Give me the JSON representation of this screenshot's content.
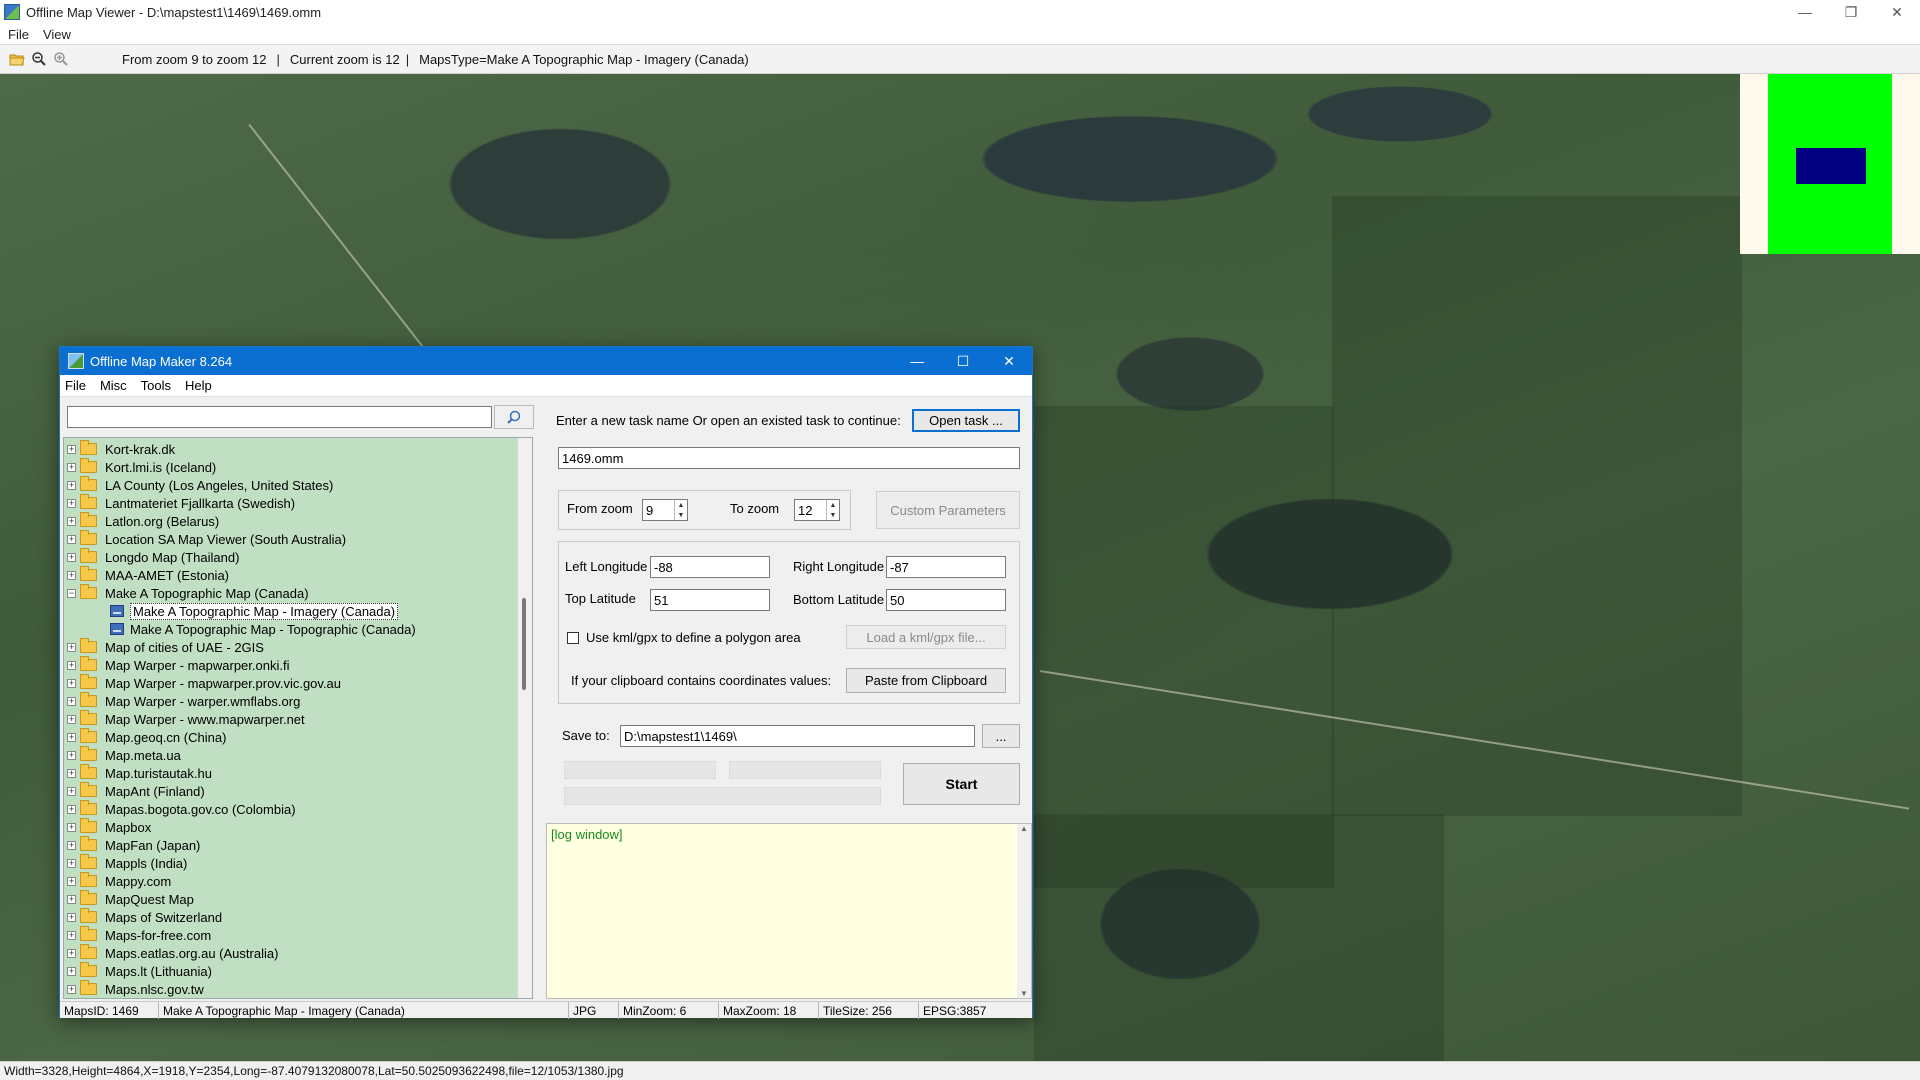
{
  "viewer": {
    "title": "Offline Map Viewer - D:\\mapstest1\\1469\\1469.omm",
    "window_buttons": {
      "minimize": "—",
      "restore": "❐",
      "close": "✕"
    },
    "menu": [
      "File",
      "View"
    ],
    "toolbar": {
      "zoom_range_text": "From zoom 9 to zoom 12",
      "sep": "|",
      "current_zoom_text": "Current zoom is 12",
      "maps_type_text": "MapsType=Make A Topographic Map - Imagery (Canada)"
    },
    "status": "Width=3328,Height=4864,X=1918,Y=2354,Long=-87.4079132080078,Lat=50.5025093622498,file=12/1053/1380.jpg",
    "minimap_colors": {
      "background": "#fff8ec",
      "coverage": "#00ff00",
      "viewport": "#000080"
    }
  },
  "dialog": {
    "title": "Offline Map Maker 8.264",
    "window_buttons": {
      "minimize": "—",
      "maximize": "☐",
      "close": "✕"
    },
    "menu": [
      "File",
      "Misc",
      "Tools",
      "Help"
    ],
    "search": {
      "value": "",
      "placeholder": ""
    },
    "tree": [
      {
        "label": "Kort-krak.dk",
        "type": "folder",
        "expander": "+"
      },
      {
        "label": "Kort.lmi.is (Iceland)",
        "type": "folder",
        "expander": "+"
      },
      {
        "label": "LA County (Los Angeles, United States)",
        "type": "folder",
        "expander": "+"
      },
      {
        "label": "Lantmateriet Fjallkarta (Swedish)",
        "type": "folder",
        "expander": "+"
      },
      {
        "label": "Latlon.org (Belarus)",
        "type": "folder",
        "expander": "+"
      },
      {
        "label": "Location SA Map Viewer (South Australia)",
        "type": "folder",
        "expander": "+"
      },
      {
        "label": "Longdo Map (Thailand)",
        "type": "folder",
        "expander": "+"
      },
      {
        "label": "MAA-AMET (Estonia)",
        "type": "folder",
        "expander": "+"
      },
      {
        "label": "Make A Topographic Map (Canada)",
        "type": "folder-open",
        "expander": "−"
      },
      {
        "label": "Make A Topographic Map - Imagery (Canada)",
        "type": "map",
        "selected": true
      },
      {
        "label": "Make A Topographic Map - Topographic (Canada)",
        "type": "map"
      },
      {
        "label": "Map of cities of UAE - 2GIS",
        "type": "folder",
        "expander": "+"
      },
      {
        "label": "Map Warper - mapwarper.onki.fi",
        "type": "folder",
        "expander": "+"
      },
      {
        "label": "Map Warper - mapwarper.prov.vic.gov.au",
        "type": "folder",
        "expander": "+"
      },
      {
        "label": "Map Warper - warper.wmflabs.org",
        "type": "folder",
        "expander": "+"
      },
      {
        "label": "Map Warper - www.mapwarper.net",
        "type": "folder",
        "expander": "+"
      },
      {
        "label": "Map.geoq.cn (China)",
        "type": "folder",
        "expander": "+"
      },
      {
        "label": "Map.meta.ua",
        "type": "folder",
        "expander": "+"
      },
      {
        "label": "Map.turistautak.hu",
        "type": "folder",
        "expander": "+"
      },
      {
        "label": "MapAnt (Finland)",
        "type": "folder",
        "expander": "+"
      },
      {
        "label": "Mapas.bogota.gov.co (Colombia)",
        "type": "folder",
        "expander": "+"
      },
      {
        "label": "Mapbox",
        "type": "folder",
        "expander": "+"
      },
      {
        "label": "MapFan (Japan)",
        "type": "folder",
        "expander": "+"
      },
      {
        "label": "Mappls (India)",
        "type": "folder",
        "expander": "+"
      },
      {
        "label": "Mappy.com",
        "type": "folder",
        "expander": "+"
      },
      {
        "label": "MapQuest Map",
        "type": "folder",
        "expander": "+"
      },
      {
        "label": "Maps of Switzerland",
        "type": "folder",
        "expander": "+"
      },
      {
        "label": "Maps-for-free.com",
        "type": "folder",
        "expander": "+"
      },
      {
        "label": "Maps.eatlas.org.au (Australia)",
        "type": "folder",
        "expander": "+"
      },
      {
        "label": "Maps.lt (Lithuania)",
        "type": "folder",
        "expander": "+"
      },
      {
        "label": "Maps.nlsc.gov.tw",
        "type": "folder",
        "expander": "+"
      }
    ],
    "task": {
      "prompt": "Enter a new task name Or open an existed task to continue:",
      "open_button": "Open task ...",
      "name_value": "1469.omm"
    },
    "zoom": {
      "from_label": "From zoom",
      "from_value": "9",
      "to_label": "To zoom",
      "to_value": "12",
      "custom_button": "Custom Parameters"
    },
    "coords": {
      "left_lon_label": "Left Longitude",
      "left_lon_value": "-88",
      "right_lon_label": "Right Longitude",
      "right_lon_value": "-87",
      "top_lat_label": "Top Latitude",
      "top_lat_value": "51",
      "bottom_lat_label": "Bottom Latitude",
      "bottom_lat_value": "50",
      "kml_checkbox_label": "Use kml/gpx to define a polygon area",
      "kml_checked": false,
      "load_kml_button": "Load a kml/gpx file...",
      "clipboard_label": "If your clipboard contains coordinates values:",
      "paste_button": "Paste from Clipboard"
    },
    "save": {
      "label": "Save to:",
      "value": "D:\\mapstest1\\1469\\",
      "browse_button": "..."
    },
    "start_button": "Start",
    "progress": [
      0,
      0,
      0
    ],
    "log_text": "[log window]",
    "status": {
      "maps_id": "MapsID: 1469",
      "maps_name": "Make A Topographic Map - Imagery (Canada)",
      "format": "JPG",
      "min_zoom": "MinZoom: 6",
      "max_zoom": "MaxZoom: 18",
      "tile_size": "TileSize: 256",
      "epsg": "EPSG:3857"
    }
  }
}
